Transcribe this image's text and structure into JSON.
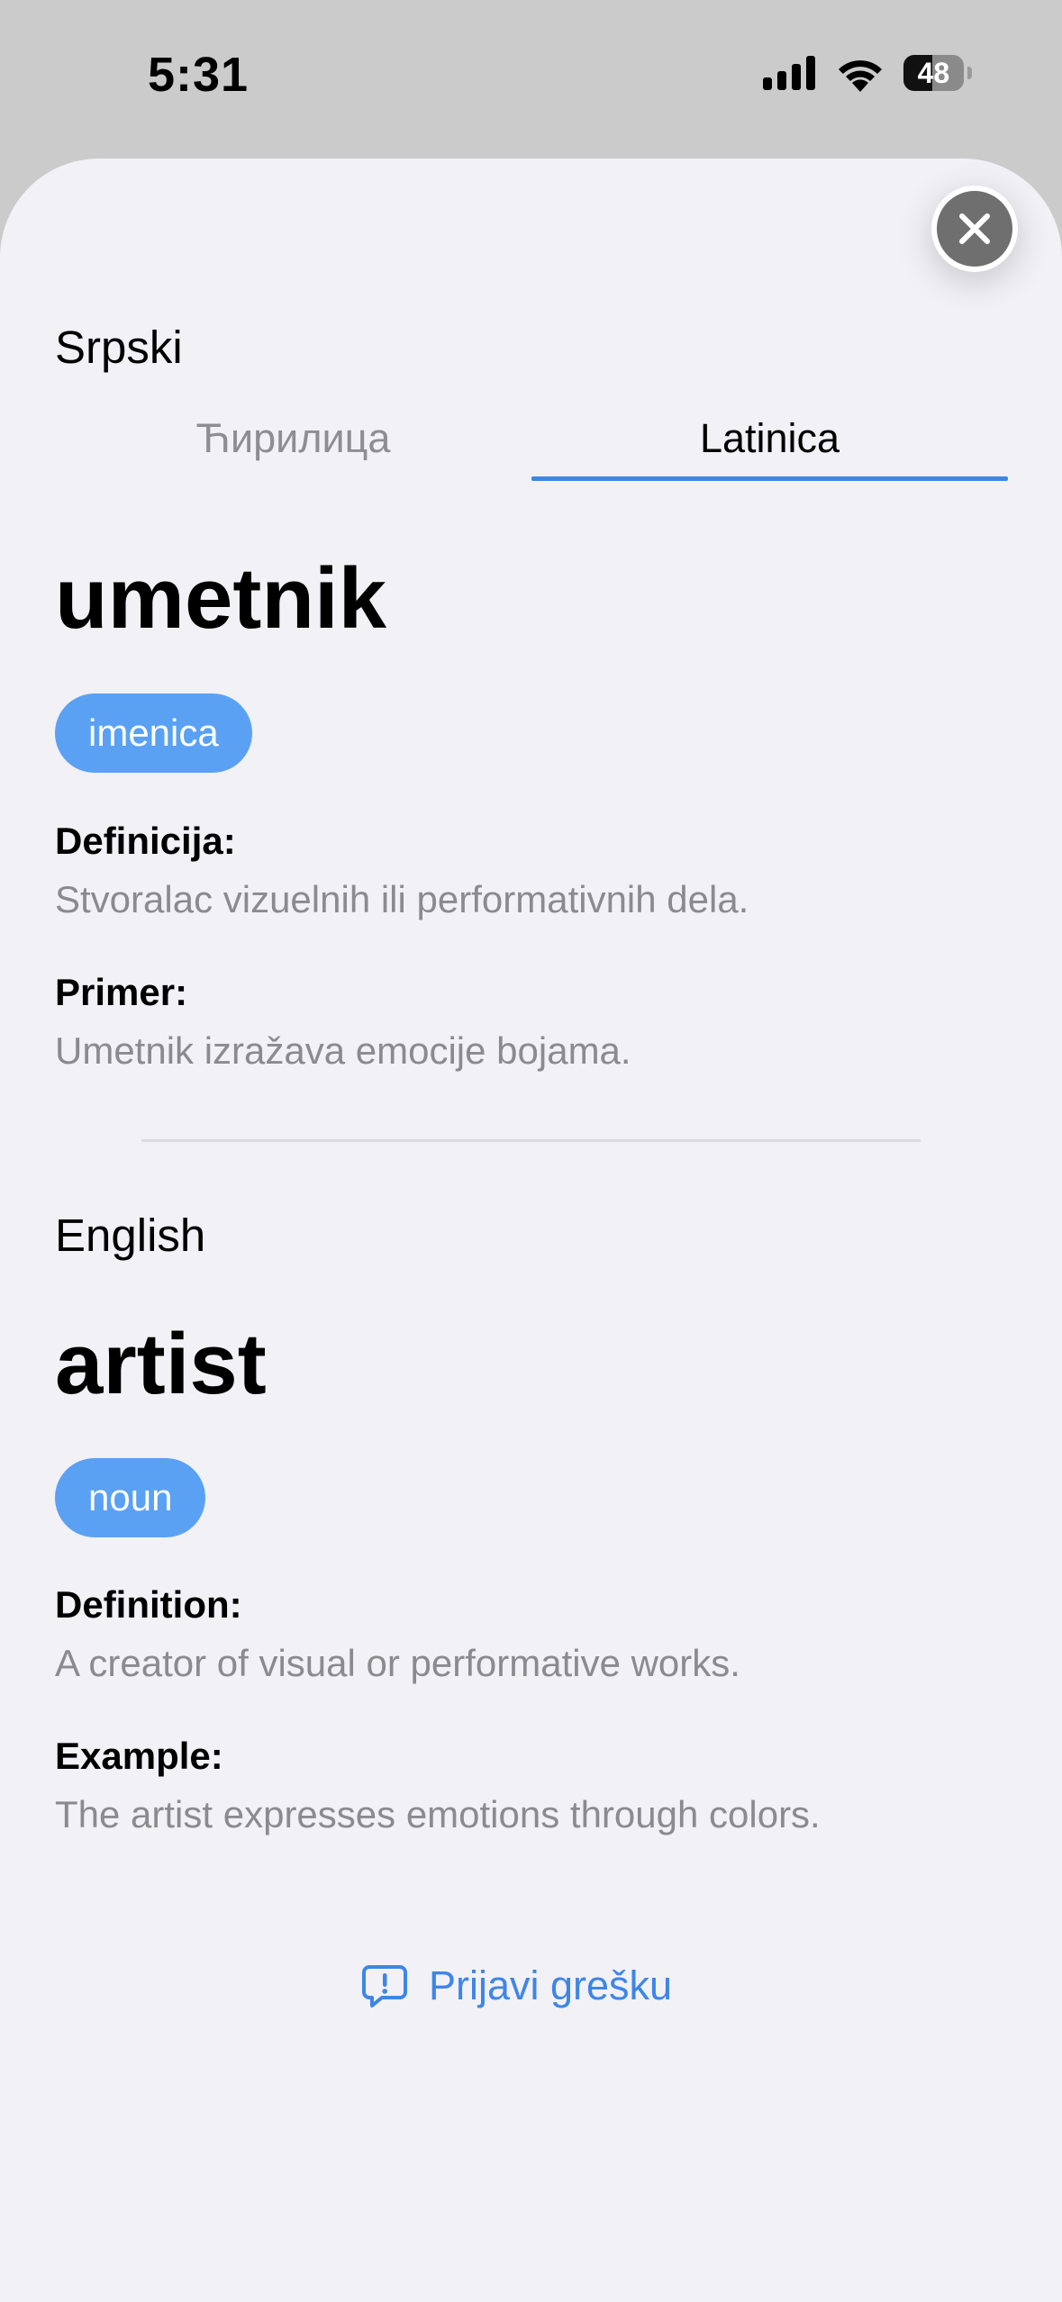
{
  "status_bar": {
    "time": "5:31",
    "battery": "48",
    "battery_fraction": 0.48
  },
  "close_button": {
    "icon": "close-icon"
  },
  "serbian": {
    "language_label": "Srpski",
    "tabs": [
      {
        "label": "Ћирилица",
        "selected": false
      },
      {
        "label": "Latinica",
        "selected": true
      }
    ],
    "word": "umetnik",
    "part_of_speech": "imenica",
    "definition_label": "Definicija:",
    "definition": "Stvoralac vizuelnih ili performativnih dela.",
    "example_label": "Primer:",
    "example": "Umetnik izražava emocije bojama."
  },
  "english": {
    "language_label": "English",
    "word": "artist",
    "part_of_speech": "noun",
    "definition_label": "Definition:",
    "definition": "A creator of visual or performative works.",
    "example_label": "Example:",
    "example": "The artist expresses emotions through colors."
  },
  "report": {
    "label": "Prijavi grešku",
    "icon": "report-bubble-icon"
  },
  "colors": {
    "accent": "#3E86E6",
    "badge": "#5AA1F4",
    "background": "#F1F1F6",
    "secondary_text": "#8A8A8F"
  }
}
